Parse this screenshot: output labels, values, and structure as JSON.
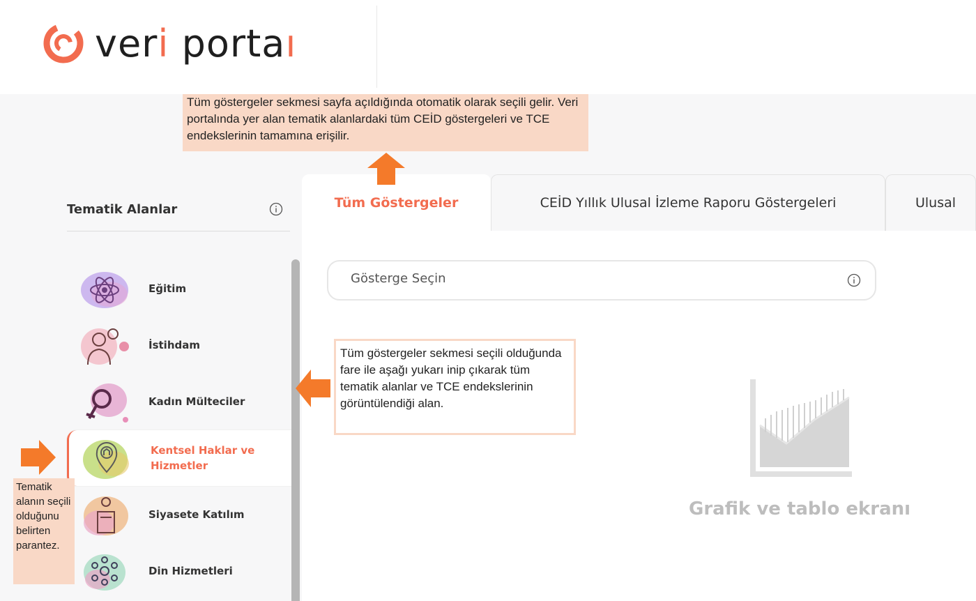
{
  "header": {
    "logo_text_v": "ver",
    "logo_text_i": "i",
    "logo_text_portal": " port",
    "logo_text_a": "a",
    "logo_text_l": "l",
    "logo_text_end": "ı"
  },
  "annotations": {
    "top": "Tüm göstergeler sekmesi sayfa açıldığında otomatik olarak seçili gelir. Veri portalında yer alan tematik alanlardaki tüm CEİD göstergeleri  ve  TCE endekslerinin tamamına erişilir.",
    "middle": "Tüm göstergeler sekmesi seçili olduğunda fare ile aşağı yukarı inip çıkarak tüm tematik alanlar ve TCE endekslerinin görüntülendiği alan.",
    "left": "Tematik alanın seçili olduğunu belirten parantez."
  },
  "sidebar": {
    "title": "Tematik Alanlar",
    "items": [
      {
        "label": "Eğitim"
      },
      {
        "label": "İstihdam"
      },
      {
        "label": "Kadın Mülteciler"
      },
      {
        "label": "Kentsel Haklar ve Hizmetler"
      },
      {
        "label": "Siyasete Katılım"
      },
      {
        "label": "Din Hizmetleri"
      }
    ]
  },
  "tabs": [
    {
      "label": "Tüm Göstergeler",
      "active": true
    },
    {
      "label": "CEİD Yıllık Ulusal İzleme Raporu Göstergeleri",
      "active": false
    },
    {
      "label": "Ulusal",
      "active": false
    }
  ],
  "search": {
    "placeholder": "Gösterge Seçin"
  },
  "graph_area": {
    "label": "Grafik ve tablo ekranı"
  },
  "colors": {
    "accent": "#f26c4f",
    "annotation_bg": "#f9d8c6",
    "arrow": "#f47a2a"
  }
}
